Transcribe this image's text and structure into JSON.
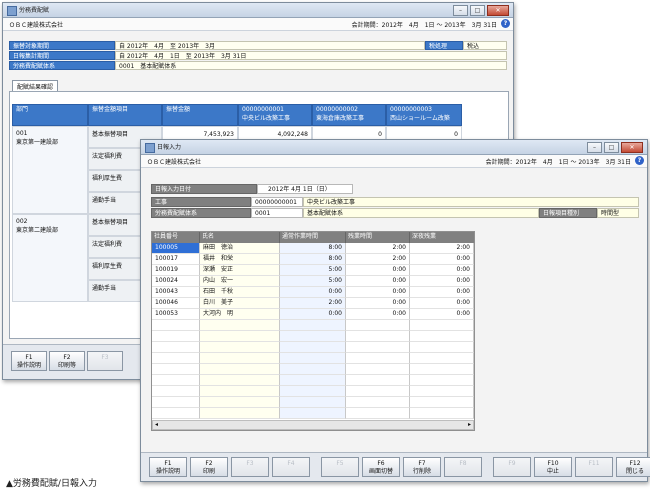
{
  "win1": {
    "title": "労務費配賦",
    "company": "ＯＢＣ建設株式会社",
    "period": "会計期間：2012年　4月　1日 ～ 2013年　3月 31日",
    "info": [
      {
        "label": "振替対象期間",
        "value": "自 2012年　4月　至 2013年　3月"
      },
      {
        "label": "日報集計期間",
        "value": "自 2012年　4月　1日　至 2013年　3月 31日"
      },
      {
        "label": "労務費配賦体系",
        "value": "0001　基本配賦体系"
      }
    ],
    "tax_label": "税処理",
    "tax_value": "税込",
    "tab": "配賦結果確認",
    "grid_headers": [
      "部門",
      "振替金額項目",
      "振替金額"
    ],
    "project_cols": [
      {
        "code": "00000000001",
        "name": "中央ビル改築工事"
      },
      {
        "code": "00000000002",
        "name": "東海倉庫改築工事"
      },
      {
        "code": "00000000003",
        "name": "西山ショールーム改築"
      }
    ],
    "departments": [
      {
        "code": "001",
        "name": "東京第一建設部",
        "items": [
          "基本振替項目",
          "法定福利費",
          "福利厚生費",
          "通勤手当"
        ],
        "first_row": [
          "7,453,923",
          "4,092,248",
          "0",
          "0"
        ]
      },
      {
        "code": "002",
        "name": "東京第二建設部",
        "items": [
          "基本振替項目",
          "法定福利費",
          "福利厚生費",
          "通勤手当"
        ]
      }
    ],
    "fkeys": [
      {
        "key": "F1",
        "label": "操作説明"
      },
      {
        "key": "F2",
        "label": "印刷等"
      },
      {
        "key": "F3",
        "label": ""
      }
    ]
  },
  "win2": {
    "title": "日報入力",
    "company": "ＯＢＣ建設株式会社",
    "period": "会計期間：2012年　4月　1日 ～ 2013年　3月 31日",
    "date_label": "日報入力日付",
    "date_value": "2012年 4月 1日（日）",
    "project_label": "工事",
    "project_code": "00000000001",
    "project_name": "中央ビル改築工事",
    "system_label": "労務費配賦体系",
    "system_code": "0001",
    "system_name": "基本配賦体系",
    "type_label": "日報項目種別",
    "type_value": "時間型",
    "columns": [
      "社員番号",
      "氏名",
      "通常作業時間",
      "残業時間",
      "深夜残業"
    ],
    "rows": [
      [
        "100005",
        "麻田　徳治",
        "8:00",
        "2:00",
        "2:00"
      ],
      [
        "100017",
        "福井　和栄",
        "8:00",
        "2:00",
        "0:00"
      ],
      [
        "100019",
        "深瀬　安正",
        "5:00",
        "0:00",
        "0:00"
      ],
      [
        "100024",
        "内山　宏一",
        "5:00",
        "0:00",
        "0:00"
      ],
      [
        "100043",
        "石田　千秋",
        "0:00",
        "0:00",
        "0:00"
      ],
      [
        "100046",
        "白川　美子",
        "2:00",
        "0:00",
        "0:00"
      ],
      [
        "100053",
        "大河内　明",
        "0:00",
        "0:00",
        "0:00"
      ]
    ],
    "fkeys": [
      {
        "key": "F1",
        "label": "操作説明",
        "enabled": true
      },
      {
        "key": "F2",
        "label": "印刷",
        "enabled": true
      },
      {
        "key": "F3",
        "label": "",
        "enabled": false
      },
      {
        "key": "F4",
        "label": "",
        "enabled": false
      },
      {
        "key": "F5",
        "label": "",
        "enabled": false
      },
      {
        "key": "F6",
        "label": "画面切替",
        "enabled": true
      },
      {
        "key": "F7",
        "label": "行削除",
        "enabled": true
      },
      {
        "key": "F8",
        "label": "",
        "enabled": false
      },
      {
        "key": "F9",
        "label": "",
        "enabled": false
      },
      {
        "key": "F10",
        "label": "中止",
        "enabled": true
      },
      {
        "key": "F11",
        "label": "",
        "enabled": false
      },
      {
        "key": "F12",
        "label": "閉じる",
        "enabled": true
      }
    ]
  },
  "caption": "▲労務費配賦/日報入力",
  "colors": {
    "header_blue": "#3c78c8",
    "header_gray": "#808080",
    "selected_cell": "#2f6fd6"
  }
}
